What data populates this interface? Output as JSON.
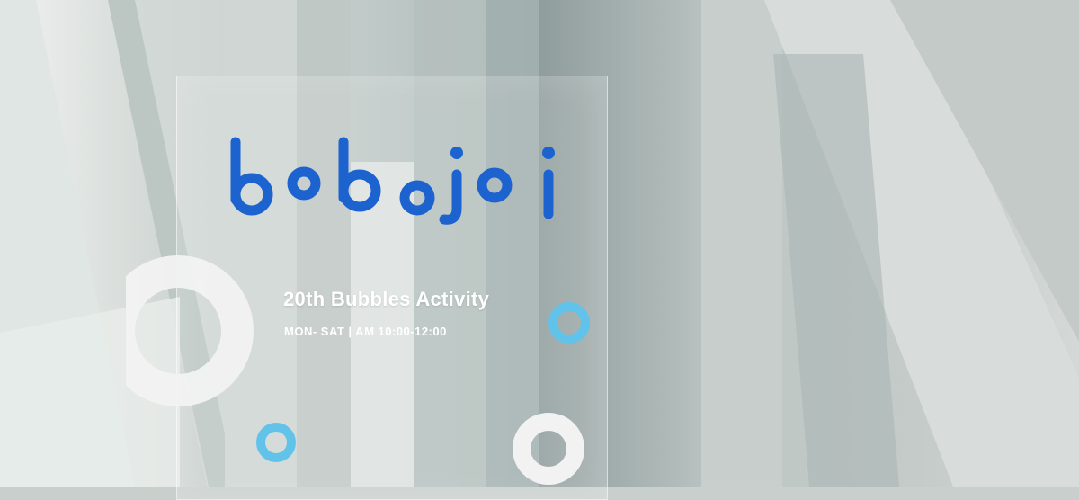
{
  "banner": {
    "logo_text": "bobojoi",
    "title": "20th Bubbles Activity",
    "schedule": "MON- SAT | AM 10:00-12:00"
  },
  "colors": {
    "logo_blue": "#1c63cf",
    "ring_light_blue": "#62c3ea",
    "ring_white": "#f2f2f2"
  }
}
